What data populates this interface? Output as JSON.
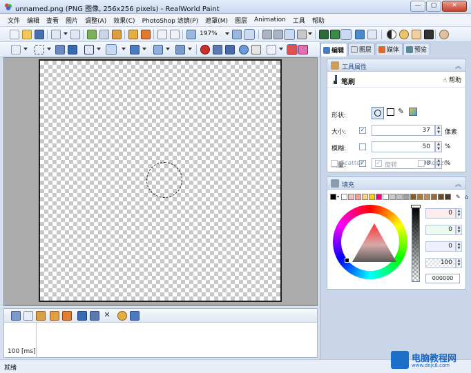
{
  "window": {
    "title": "unnamed.png (PNG 图像, 256x256 pixels) - RealWorld Paint",
    "min_label": "—",
    "max_label": "▢",
    "close_label": "✕"
  },
  "menu": [
    "文件",
    "编辑",
    "查看",
    "图片",
    "调整(A)",
    "效果(C)",
    "PhotoShop 滤镜(P)",
    "遮罩(M)",
    "图层",
    "Animation",
    "工具",
    "帮助"
  ],
  "toolbar": {
    "zoom": "197%"
  },
  "animation": {
    "frame_time": "100 [ms]"
  },
  "status": {
    "text": "就绪"
  },
  "panel": {
    "tabs": [
      {
        "label": "编辑",
        "icon": "edit-icon",
        "active": true
      },
      {
        "label": "图层",
        "icon": "layers-icon",
        "active": false
      },
      {
        "label": "媒体",
        "icon": "media-icon",
        "active": false
      },
      {
        "label": "预览",
        "icon": "preview-icon",
        "active": false
      }
    ],
    "tool_properties": {
      "title": "工具属性",
      "tool_name": "笔刷",
      "help": "帮助",
      "shape_label": "形状:",
      "size_label": "大小:",
      "size_value": "37",
      "size_unit": "像素",
      "blur_label": "模糊:",
      "blur_value": "50",
      "blur_unit": "%",
      "flow_label": "流量:",
      "flow_value": "100",
      "flow_unit": "%",
      "scatter": "Scatter",
      "rotate": "旋转",
      "resize": "Resize"
    },
    "fill": {
      "title": "填充",
      "r": "0",
      "g": "0",
      "b": "0",
      "alpha": "100",
      "hex": "000000"
    }
  },
  "watermark": {
    "title": "电脑教程网",
    "subtitle": "www.dnjc8.com"
  },
  "colors": {
    "palette": [
      "#000000",
      "#ffffff",
      "#f3c0c0",
      "#ff9a9a",
      "#ffd080",
      "#ffcc00",
      "#ff0080",
      "#ffffff",
      "#cccccc",
      "#c0c0c0",
      "#a0a0a0",
      "#8b5a2b",
      "#b07830",
      "#c09050",
      "#9a6a3a",
      "#6b4a2a",
      "#4a3a2a"
    ]
  }
}
